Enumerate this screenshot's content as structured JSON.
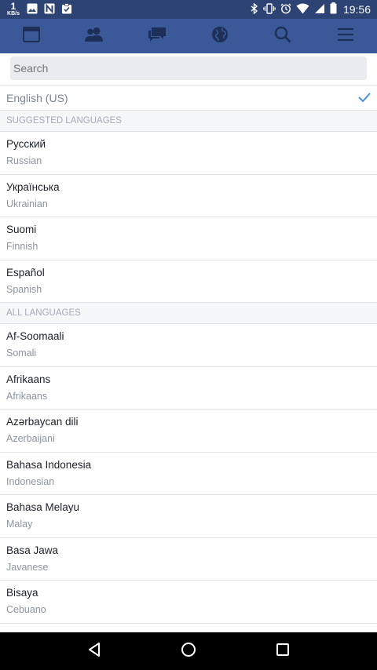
{
  "status_bar": {
    "net_speed": "1",
    "net_unit": "KB/s",
    "time": "19:56"
  },
  "nav": {
    "items": [
      {
        "icon": "news-feed-icon"
      },
      {
        "icon": "friends-icon"
      },
      {
        "icon": "messages-icon"
      },
      {
        "icon": "globe-icon"
      },
      {
        "icon": "search-icon"
      },
      {
        "icon": "menu-icon"
      }
    ],
    "bg_color": "#3b5998"
  },
  "search": {
    "placeholder": "Search"
  },
  "current_language": {
    "label": "English (US)",
    "check_color": "#4a90e2"
  },
  "sections": {
    "suggested_header": "SUGGESTED LANGUAGES",
    "all_header": "ALL LANGUAGES"
  },
  "suggested": [
    {
      "native": "Русский",
      "english": "Russian"
    },
    {
      "native": "Українська",
      "english": "Ukrainian"
    },
    {
      "native": "Suomi",
      "english": "Finnish"
    },
    {
      "native": "Español",
      "english": "Spanish"
    }
  ],
  "all": [
    {
      "native": "Af-Soomaali",
      "english": "Somali"
    },
    {
      "native": "Afrikaans",
      "english": "Afrikaans"
    },
    {
      "native": "Azərbaycan dili",
      "english": "Azerbaijani"
    },
    {
      "native": "Bahasa Indonesia",
      "english": "Indonesian"
    },
    {
      "native": "Bahasa Melayu",
      "english": "Malay"
    },
    {
      "native": "Basa Jawa",
      "english": "Javanese"
    },
    {
      "native": "Bisaya",
      "english": "Cebuano"
    }
  ]
}
